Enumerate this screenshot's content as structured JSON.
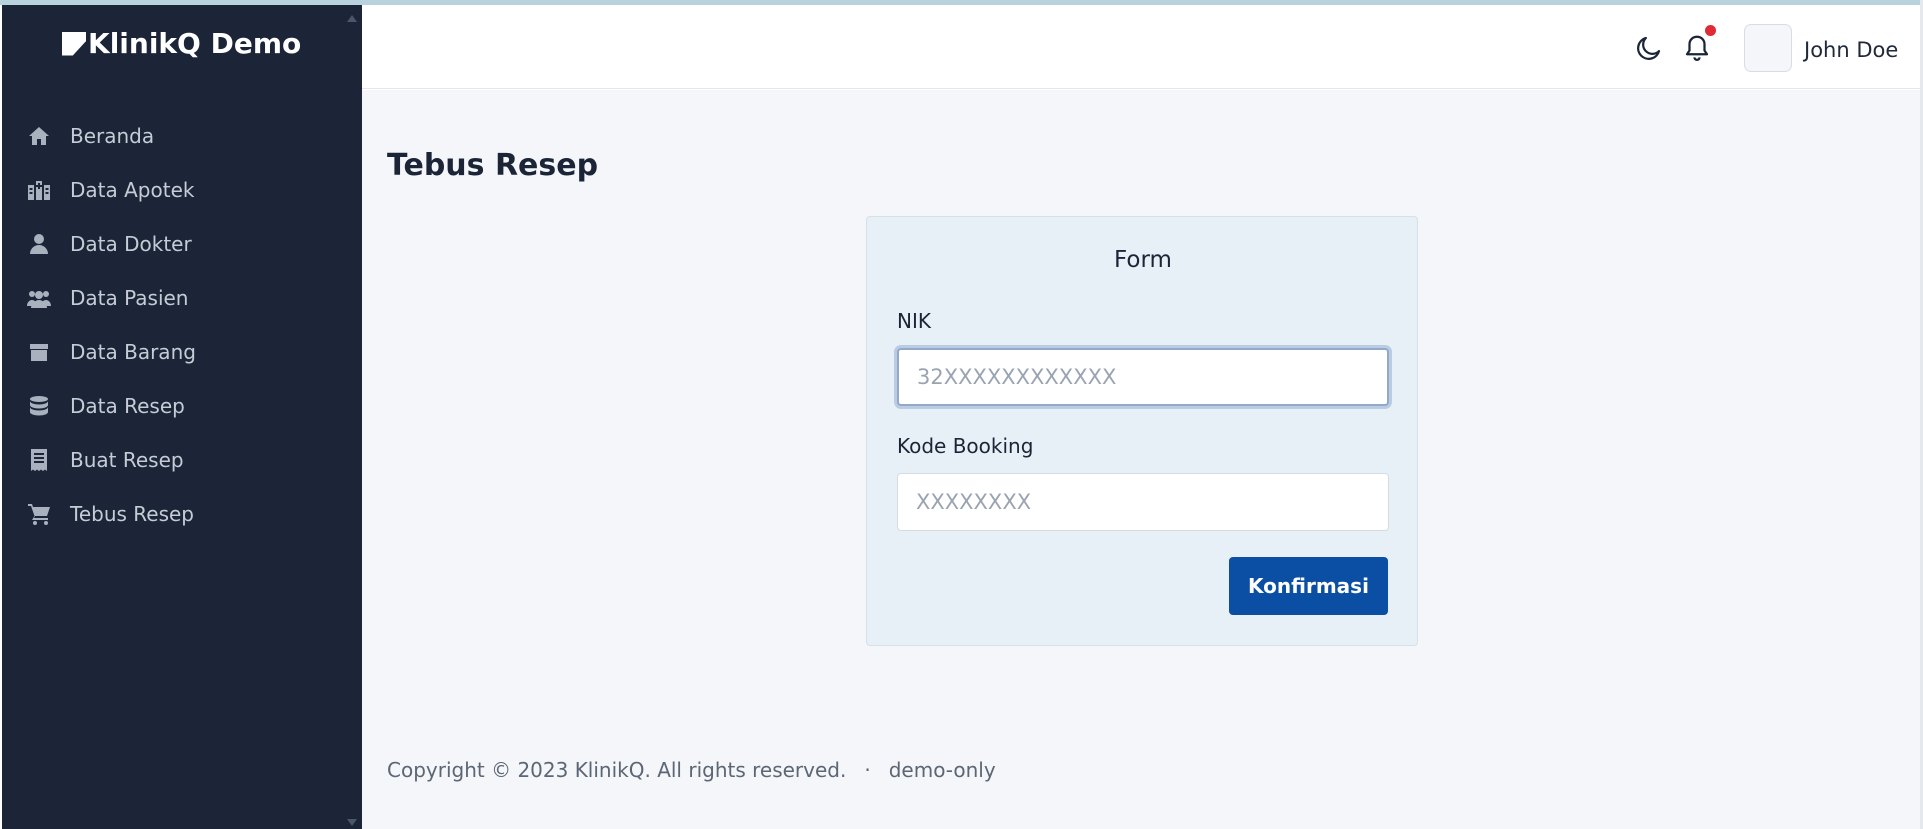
{
  "app": {
    "brand": "KlinikQ Demo"
  },
  "sidebar": {
    "items": [
      {
        "label": "Beranda",
        "icon": "home-icon"
      },
      {
        "label": "Data Apotek",
        "icon": "hospital-icon"
      },
      {
        "label": "Data Dokter",
        "icon": "doctor-icon"
      },
      {
        "label": "Data Pasien",
        "icon": "users-icon"
      },
      {
        "label": "Data Barang",
        "icon": "box-icon"
      },
      {
        "label": "Data Resep",
        "icon": "database-icon"
      },
      {
        "label": "Buat Resep",
        "icon": "receipt-icon"
      },
      {
        "label": "Tebus Resep",
        "icon": "cart-icon"
      }
    ]
  },
  "header": {
    "username": "John Doe",
    "notification_dot_color": "#e02a35"
  },
  "main": {
    "page_title": "Tebus Resep",
    "form": {
      "title": "Form",
      "nik_label": "NIK",
      "nik_value": "",
      "nik_placeholder": "32XXXXXXXXXXXX",
      "booking_label": "Kode Booking",
      "booking_value": "",
      "booking_placeholder": "XXXXXXXX",
      "confirm_label": "Konfirmasi"
    }
  },
  "footer": {
    "copyright": "Copyright © 2023 KlinikQ. All rights reserved.",
    "separator": "·",
    "note": "demo-only"
  },
  "colors": {
    "sidebar_bg": "#1b2537",
    "primary_button": "#0b4fa4",
    "main_bg": "#f4f6f9"
  }
}
